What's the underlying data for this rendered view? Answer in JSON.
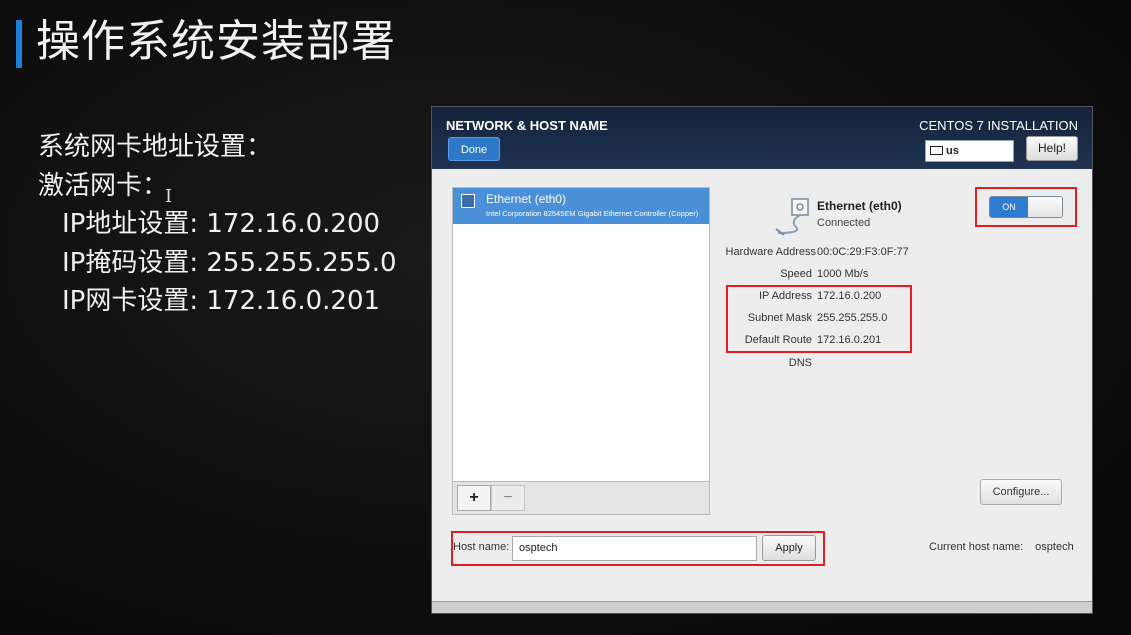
{
  "slide": {
    "title": "操作系统安装部署",
    "notes": [
      "系统网卡地址设置：",
      "激活网卡：",
      "IP地址设置: 172.16.0.200",
      "IP掩码设置: 255.255.255.0",
      "IP网卡设置: 172.16.0.201"
    ]
  },
  "installer": {
    "header_title": "NETWORK & HOST NAME",
    "brand": "CENTOS 7 INSTALLATION",
    "done_label": "Done",
    "keyboard_layout": "us",
    "help_label": "Help!",
    "devices": [
      {
        "name": "Ethernet (eth0)",
        "description": "Intel Corporation 82545EM Gigabit Ethernet Controller (Copper)"
      }
    ],
    "add_label": "+",
    "remove_label": "−",
    "iface_name": "Ethernet (eth0)",
    "iface_status": "Connected",
    "toggle_label": "ON",
    "toggle_state": "on",
    "details": {
      "hardware_address_label": "Hardware Address",
      "hardware_address": "00:0C:29:F3:0F:77",
      "speed_label": "Speed",
      "speed": "1000 Mb/s",
      "ip_label": "IP Address",
      "ip": "172.16.0.200",
      "mask_label": "Subnet Mask",
      "mask": "255.255.255.0",
      "route_label": "Default Route",
      "route": "172.16.0.201",
      "dns_label": "DNS"
    },
    "configure_label": "Configure...",
    "host_name_label": "Host name:",
    "host_name_value": "osptech",
    "apply_label": "Apply",
    "current_host_label": "Current host name:",
    "current_host_value": "osptech",
    "highlight_color": "#e02020",
    "accent_color": "#2f7bd2"
  }
}
